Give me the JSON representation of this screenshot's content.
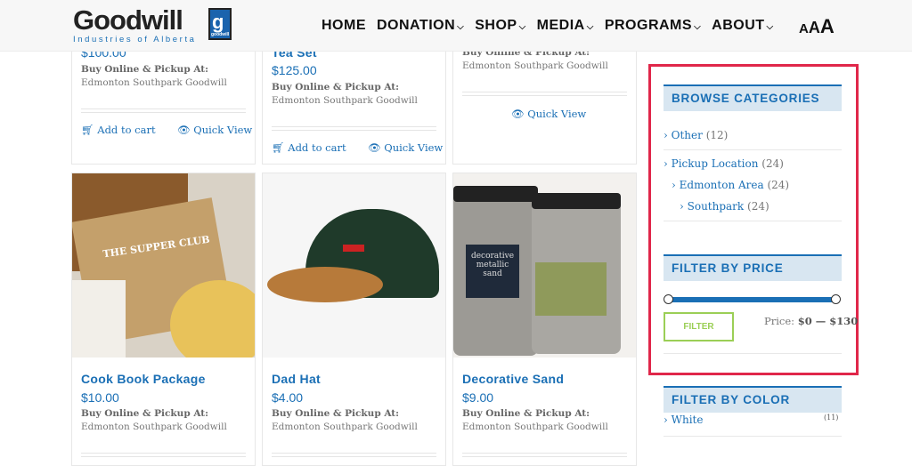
{
  "header": {
    "logo_word": "Goodwill",
    "logo_sub": "Industries of Alberta",
    "logo_badge": "goodwill",
    "nav": [
      {
        "label": "HOME",
        "dropdown": false
      },
      {
        "label": "DONATION",
        "dropdown": true
      },
      {
        "label": "SHOP",
        "dropdown": true
      },
      {
        "label": "MEDIA",
        "dropdown": true
      },
      {
        "label": "PROGRAMS",
        "dropdown": true
      },
      {
        "label": "ABOUT",
        "dropdown": true
      }
    ],
    "font_size_controls": [
      "A",
      "A",
      "A"
    ]
  },
  "products_top": [
    {
      "title": "",
      "price": "$100.00",
      "buy": "Buy Online & Pickup At:",
      "location": "Edmonton Southpark Goodwill",
      "add": "Add to cart",
      "quick": "Quick View"
    },
    {
      "title": "Tea Set",
      "price": "$125.00",
      "buy": "Buy Online & Pickup At:",
      "location": "Edmonton Southpark Goodwill",
      "add": "Add to cart",
      "quick": "Quick View"
    },
    {
      "title": "",
      "price": "",
      "buy": "Buy Online & Pickup At:",
      "location": "Edmonton Southpark Goodwill",
      "quick": "Quick View"
    }
  ],
  "products": [
    {
      "title": "Cook Book Package",
      "price": "$10.00",
      "buy": "Buy Online & Pickup At:",
      "location": "Edmonton Southpark Goodwill",
      "image_text": "THE SUPPER CLUB"
    },
    {
      "title": "Dad Hat",
      "price": "$4.00",
      "buy": "Buy Online & Pickup At:",
      "location": "Edmonton Southpark Goodwill"
    },
    {
      "title": "Decorative Sand",
      "price": "$9.00",
      "buy": "Buy Online & Pickup At:",
      "location": "Edmonton Southpark Goodwill",
      "image_text": "decorative metallic sand"
    }
  ],
  "sidebar": {
    "browse_title": "BROWSE CATEGORIES",
    "categories": [
      {
        "label": "Other",
        "count": "(12)"
      },
      {
        "label": "Pickup Location",
        "count": "(24)"
      },
      {
        "label": "Edmonton Area",
        "count": "(24)"
      },
      {
        "label": "Southpark",
        "count": "(24)"
      }
    ],
    "price_title": "FILTER BY PRICE",
    "filter_label": "FILTER",
    "price_label": "Price:",
    "price_range": "$0 — $130",
    "price_min": 0,
    "price_max": 130,
    "color_title": "FILTER BY COLOR",
    "colors": [
      {
        "label": "White",
        "count": "(11)"
      }
    ]
  },
  "colors": {
    "accent": "#1a6fb5",
    "highlight": "#e0274a",
    "filter_button": "#9bcf56"
  }
}
